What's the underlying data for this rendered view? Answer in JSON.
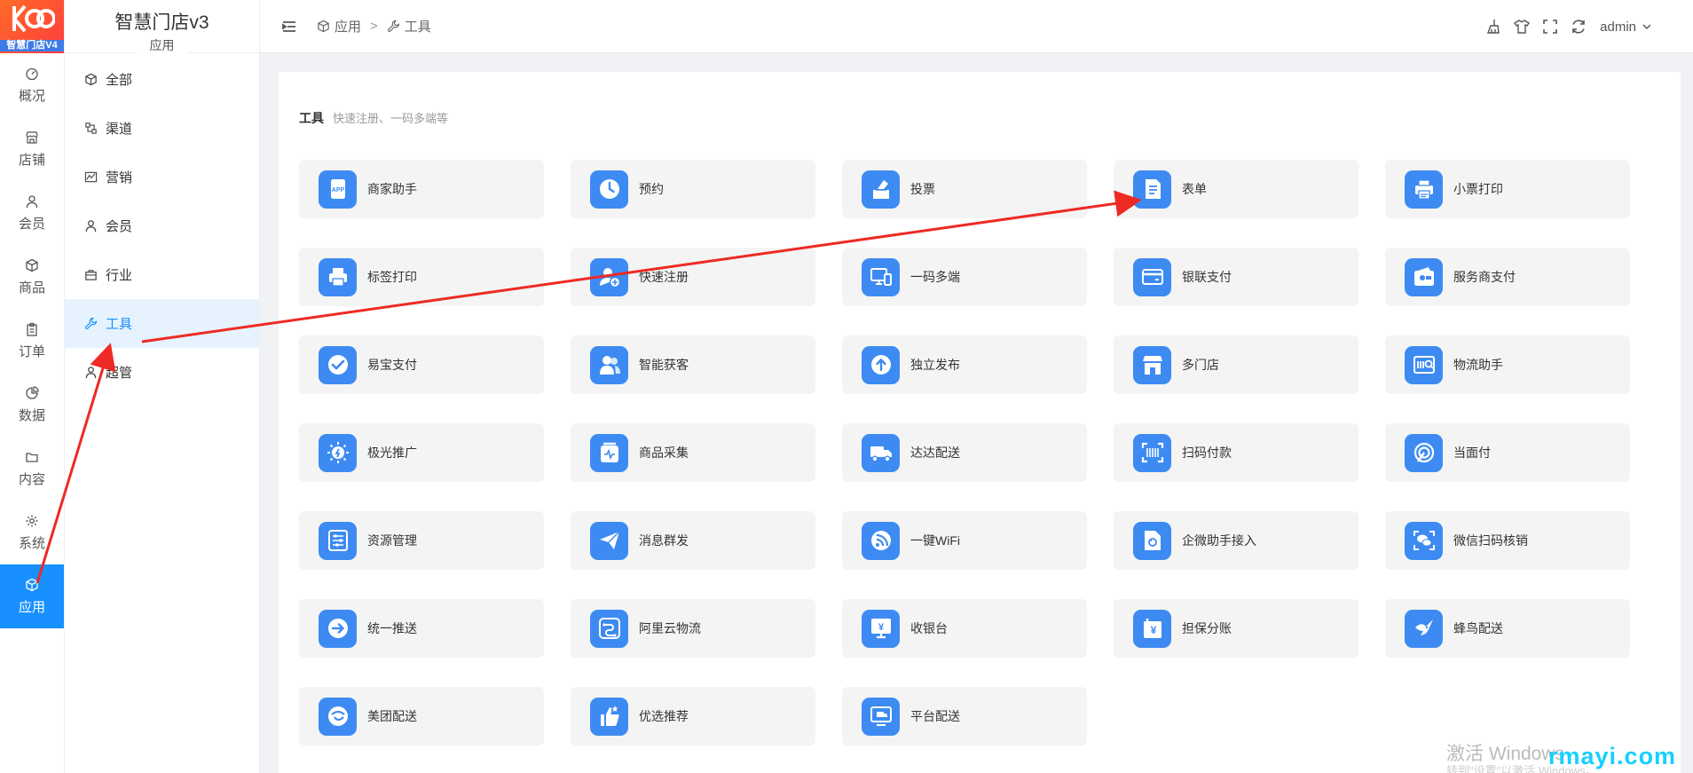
{
  "logo": {
    "text": "智慧门店V4"
  },
  "rail": [
    {
      "label": "概况",
      "icon": "dashboard-icon"
    },
    {
      "label": "店铺",
      "icon": "shop-icon"
    },
    {
      "label": "会员",
      "icon": "user-icon"
    },
    {
      "label": "商品",
      "icon": "box-icon"
    },
    {
      "label": "订单",
      "icon": "clipboard-icon"
    },
    {
      "label": "数据",
      "icon": "pie-icon"
    },
    {
      "label": "内容",
      "icon": "folder-icon"
    },
    {
      "label": "系统",
      "icon": "gear-icon"
    },
    {
      "label": "应用",
      "icon": "cube-icon",
      "active": true
    }
  ],
  "submenu": {
    "title": "智慧门店v3",
    "caption": "应用",
    "items": [
      {
        "label": "全部",
        "icon": "cube-icon"
      },
      {
        "label": "渠道",
        "icon": "channel-icon"
      },
      {
        "label": "营销",
        "icon": "chart-icon"
      },
      {
        "label": "会员",
        "icon": "user-icon"
      },
      {
        "label": "行业",
        "icon": "briefcase-icon"
      },
      {
        "label": "工具",
        "icon": "wrench-icon",
        "active": true
      },
      {
        "label": "超管",
        "icon": "user-icon"
      }
    ]
  },
  "breadcrumb": {
    "first": "应用",
    "separator": ">",
    "current": "工具"
  },
  "header": {
    "user": "admin"
  },
  "section": {
    "title": "工具",
    "subtitle": "快速注册、一码多端等"
  },
  "apps": [
    {
      "label": "商家助手",
      "icon": "app-icon"
    },
    {
      "label": "预约",
      "icon": "clock-icon"
    },
    {
      "label": "投票",
      "icon": "vote-icon"
    },
    {
      "label": "表单",
      "icon": "form-icon"
    },
    {
      "label": "小票打印",
      "icon": "receipt-printer-icon"
    },
    {
      "label": "标签打印",
      "icon": "printer-icon"
    },
    {
      "label": "快速注册",
      "icon": "user-plus-icon"
    },
    {
      "label": "一码多端",
      "icon": "devices-icon"
    },
    {
      "label": "银联支付",
      "icon": "card-icon"
    },
    {
      "label": "服务商支付",
      "icon": "wallet-icon"
    },
    {
      "label": "易宝支付",
      "icon": "check-bubble-icon"
    },
    {
      "label": "智能获客",
      "icon": "users-icon"
    },
    {
      "label": "独立发布",
      "icon": "upload-icon"
    },
    {
      "label": "多门店",
      "icon": "store-icon"
    },
    {
      "label": "物流助手",
      "icon": "logistics-icon"
    },
    {
      "label": "极光推广",
      "icon": "aurora-icon"
    },
    {
      "label": "商品采集",
      "icon": "collect-icon"
    },
    {
      "label": "达达配送",
      "icon": "truck-icon"
    },
    {
      "label": "扫码付款",
      "icon": "scan-icon"
    },
    {
      "label": "当面付",
      "icon": "pay-icon"
    },
    {
      "label": "资源管理",
      "icon": "sliders-icon"
    },
    {
      "label": "消息群发",
      "icon": "send-icon"
    },
    {
      "label": "一键WiFi",
      "icon": "wifi-icon"
    },
    {
      "label": "企微助手接入",
      "icon": "wecom-icon"
    },
    {
      "label": "微信扫码核销",
      "icon": "wechat-icon"
    },
    {
      "label": "统一推送",
      "icon": "push-icon"
    },
    {
      "label": "阿里云物流",
      "icon": "cloud-icon"
    },
    {
      "label": "收银台",
      "icon": "cashier-icon"
    },
    {
      "label": "担保分账",
      "icon": "guarantee-icon"
    },
    {
      "label": "蜂鸟配送",
      "icon": "bird-icon"
    },
    {
      "label": "美团配送",
      "icon": "meituan-icon"
    },
    {
      "label": "优选推荐",
      "icon": "thumbs-up-icon"
    },
    {
      "label": "平台配送",
      "icon": "platform-icon"
    }
  ],
  "watermark": {
    "line1": "激活 Windows",
    "line2": "转到\"设置\"以激活 Windows。",
    "site": "rmayi.com"
  },
  "colors": {
    "accent": "#1890ff",
    "tile_icon": "#3d8bf2",
    "annotation": "#ee2a24"
  }
}
